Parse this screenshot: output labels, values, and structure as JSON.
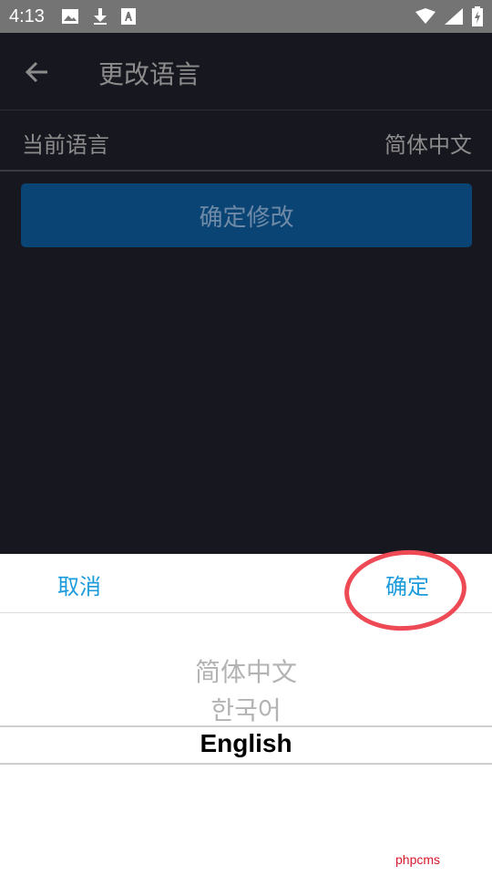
{
  "status_bar": {
    "time": "4:13",
    "icons_left": [
      "image-icon",
      "download-icon",
      "font-icon"
    ],
    "icons_right": [
      "wifi-icon",
      "signal-icon",
      "battery-charging-icon"
    ]
  },
  "toolbar": {
    "back_icon": "arrow-left-icon",
    "title": "更改语言"
  },
  "current_language": {
    "label": "当前语言",
    "value": "简体中文"
  },
  "confirm_change_button": "确定修改",
  "picker": {
    "cancel_label": "取消",
    "ok_label": "确定",
    "options": [
      "简体中文",
      "한국어",
      "English"
    ],
    "selected": "English",
    "highlight_color": "#ee4a55"
  },
  "watermark": "phpcms",
  "colors": {
    "accent": "#1b9bdc",
    "button_bg": "#0a4474",
    "app_bg": "#17171f"
  }
}
